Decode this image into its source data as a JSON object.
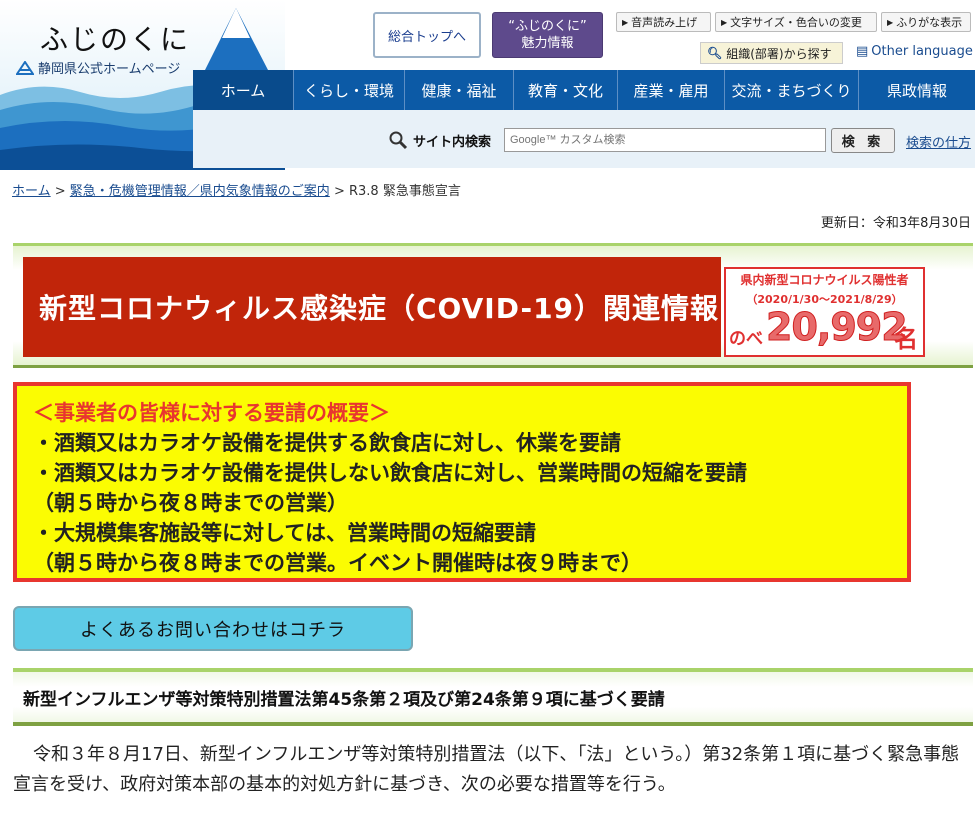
{
  "header": {
    "logo_title": "ふじのくに",
    "logo_subtitle": "静岡県公式ホームページ",
    "btn_top": "総合トップへ",
    "btn_charm_line1": "“ふじのくに”",
    "btn_charm_line2": "魅力情報",
    "util_voice": "音声読み上げ",
    "util_size": "文字サイズ・色合いの変更",
    "util_ruby": "ふりがな表示",
    "org_search": "組織(部署)から探す",
    "other_language": "Other language"
  },
  "global_nav": [
    "ホーム",
    "くらし・環境",
    "健康・福祉",
    "教育・文化",
    "産業・雇用",
    "交流・まちづくり",
    "県政情報"
  ],
  "search": {
    "label": "サイト内検索",
    "placeholder": "Google™ カスタム検索",
    "button": "検 索",
    "help": "検索の仕方"
  },
  "breadcrumb": {
    "home": "ホーム",
    "sep": " > ",
    "parent": "緊急・危機管理情報／県内気象情報のご案内",
    "current": "R3.8 緊急事態宣言"
  },
  "updated": "更新日：令和3年8月30日",
  "covid_banner": {
    "title": "新型コロナウィルス感染症（COVID-19）関連情報",
    "count_label": "県内新型コロナウイルス陽性者",
    "count_period": "（2020/1/30〜2021/8/29）",
    "count_prefix": "のべ",
    "count_value": "20,992",
    "count_suffix": "名"
  },
  "request_box": {
    "heading": "＜事業者の皆様に対する要請の概要＞",
    "lines": [
      "・酒類又はカラオケ設備を提供する飲食店に対し、休業を要請",
      "・酒類又はカラオケ設備を提供しない飲食店に対し、営業時間の短縮を要請",
      "（朝５時から夜８時までの営業）",
      "・大規模集客施設等に対しては、営業時間の短縮要請",
      "（朝５時から夜８時までの営業。イベント開催時は夜９時まで）"
    ]
  },
  "faq_button": "よくあるお問い合わせはコチラ",
  "section_heading": "新型インフルエンザ等対策特別措置法第45条第２項及び第24条第９項に基づく要請",
  "body_text": "令和３年８月17日、新型インフルエンザ等対策特別措置法（以下、「法」という。）第32条第１項に基づく緊急事態宣言を受け、政府対策本部の基本的対処方針に基づき、次の必要な措置等を行う。",
  "colors": {
    "nav_blue": "#0c5aa6",
    "covid_red": "#c1250a",
    "request_yellow": "#fbfc02",
    "request_border": "#e8362f",
    "faq_cyan": "#5ecbe6",
    "accent_green": "#7ea142"
  }
}
